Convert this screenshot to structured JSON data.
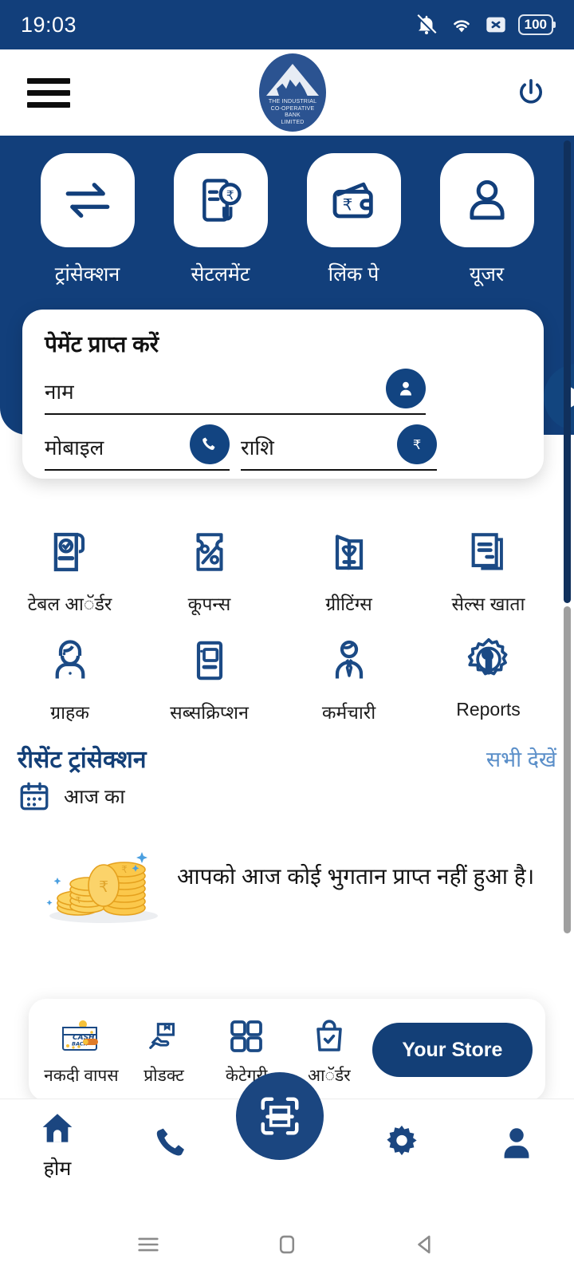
{
  "status_bar": {
    "time": "19:03",
    "battery": "100",
    "icons": [
      "bell-muted-icon",
      "wifi-icon",
      "x-box-icon",
      "battery-icon"
    ]
  },
  "header": {
    "menu_icon": "hamburger-menu-icon",
    "power_icon": "power-icon",
    "logo_lines": [
      "THE INDUSTRIAL",
      "CO-OPERATIVE",
      "BANK",
      "LIMITED"
    ]
  },
  "quick_actions": [
    {
      "label": "ट्रांसेक्शन",
      "icon": "transfer-arrows-icon"
    },
    {
      "label": "सेटलमेंट",
      "icon": "invoice-rupee-icon"
    },
    {
      "label": "लिंक पे",
      "icon": "wallet-rupee-icon"
    },
    {
      "label": "यूजर",
      "icon": "user-icon"
    }
  ],
  "payment_card": {
    "title": "पेमेंट प्राप्त करें",
    "name_placeholder": "नाम",
    "mobile_placeholder": "मोबाइल",
    "amount_placeholder": "राशि",
    "name_icon": "person-circle-icon",
    "mobile_icon": "phone-circle-icon",
    "amount_icon": "rupee-circle-icon",
    "send_icon": "send-arrow-icon"
  },
  "services": [
    {
      "label": "टेबल आॅर्डर",
      "icon": "table-order-icon"
    },
    {
      "label": "कूपन्स",
      "icon": "coupon-percent-icon"
    },
    {
      "label": "ग्रीटिंग्स",
      "icon": "greeting-card-heart-icon"
    },
    {
      "label": "सेल्स खाता",
      "icon": "sales-ledger-icon"
    },
    {
      "label": "ग्राहक",
      "icon": "customer-icon"
    },
    {
      "label": "सब्सक्रिप्शन",
      "icon": "subscription-device-icon"
    },
    {
      "label": "कर्मचारी",
      "icon": "employee-tie-icon"
    },
    {
      "label": "Reports",
      "icon": "gear-wrench-icon"
    }
  ],
  "recent": {
    "title": "रीसेंट ट्रांसेक्शन",
    "see_all": "सभी देखें",
    "today_label": "आज का",
    "calendar_icon": "calendar-icon",
    "empty_message": "आपको आज कोई भुगतान प्राप्त नहीं हुआ है।",
    "empty_icon": "coin-stack-icon"
  },
  "store_card": {
    "items": [
      {
        "label": "नकदी वापस",
        "icon": "cashback-wallet-icon"
      },
      {
        "label": "प्रोडक्ट",
        "icon": "hand-package-icon"
      },
      {
        "label": "केटेगरी",
        "icon": "grid-squares-icon"
      },
      {
        "label": "आॅर्डर",
        "icon": "shopping-bag-check-icon"
      }
    ],
    "button_label": "Your Store"
  },
  "bottom_nav": {
    "items": [
      {
        "label": "होम",
        "icon": "home-icon"
      },
      {
        "label": "",
        "icon": "phone-icon"
      },
      {
        "label": "",
        "icon": "settings-gear-icon"
      },
      {
        "label": "",
        "icon": "profile-person-icon"
      }
    ],
    "fab_icon": "qr-scan-icon"
  },
  "android_nav": {
    "recent_icon": "recent-apps-icon",
    "home_icon": "home-square-icon",
    "back_icon": "back-triangle-icon"
  },
  "colors": {
    "brand_blue": "#123f7b",
    "accent_link": "#5b8fc9",
    "gold": "#f5b935"
  }
}
